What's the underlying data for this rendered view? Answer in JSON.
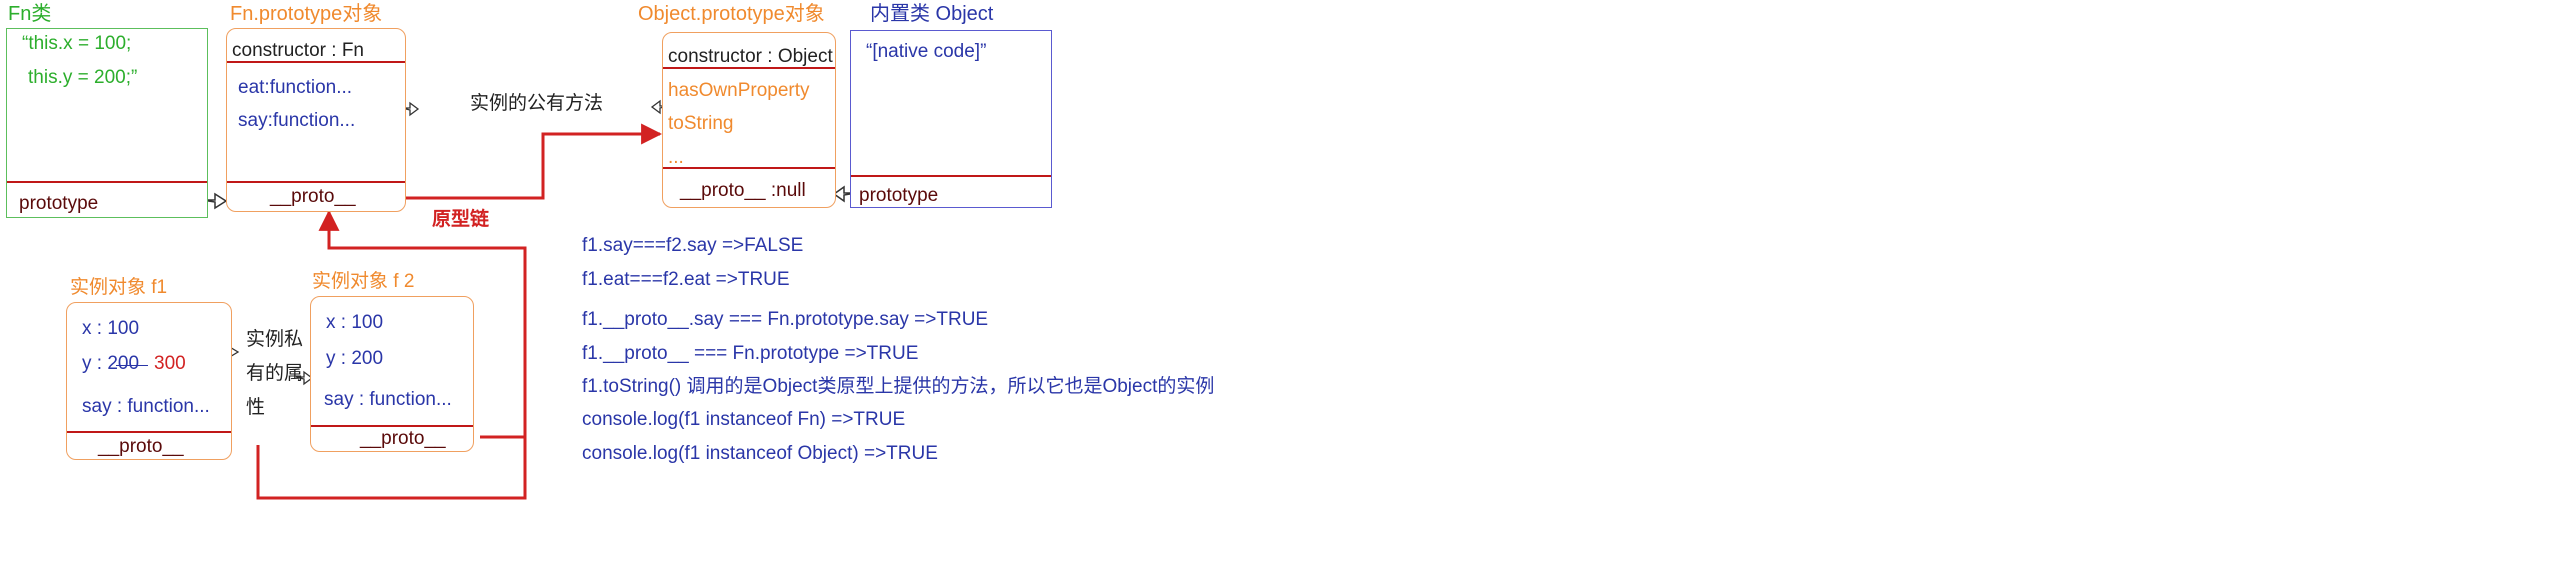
{
  "fn_box": {
    "title": "Fn类",
    "code_line1": "“this.x = 100;",
    "code_line2": "this.y = 200;”",
    "prototype": "prototype"
  },
  "fn_prototype_box": {
    "title": "Fn.prototype对象",
    "constructor": "constructor : Fn",
    "method1": "eat:function...",
    "method2": "say:function...",
    "proto": "__proto__"
  },
  "public_methods_label": "实例的公有方法",
  "object_prototype_box": {
    "title": "Object.prototype对象",
    "constructor": "constructor : Object",
    "method1": "hasOwnProperty",
    "method2": "toString",
    "ellipsis": "...",
    "proto": "__proto__ :null"
  },
  "object_box": {
    "title": "内置类 Object",
    "code": "“[native code]”",
    "prototype": "prototype"
  },
  "prototype_chain_label": "原型链",
  "instance_f1": {
    "title": "实例对象  f1",
    "x": "x : 100",
    "y_old": "y : 200",
    "y_new": "300",
    "say": "say : function...",
    "proto": "__proto__"
  },
  "private_label": {
    "line1": "实例私",
    "line2": "有的属",
    "line3": "性"
  },
  "instance_f2": {
    "title": "实例对象  f 2",
    "x": "x : 100",
    "y": "y : 200",
    "say": "say : function...",
    "proto": "__proto__"
  },
  "notes": [
    "f1.say===f2.say    =>FALSE",
    "f1.eat===f2.eat     =>TRUE",
    "f1.__proto__.say   === Fn.prototype.say    =>TRUE",
    "f1.__proto__ === Fn.prototype    =>TRUE",
    "f1.toString()    调用的是Object类原型上提供的方法，所以它也是Object的实例",
    "console.log(f1 instanceof Fn)    =>TRUE",
    "console.log(f1 instanceof Object)    =>TRUE"
  ],
  "colors": {
    "orange": "#f08a2e",
    "blue": "#2a36a8",
    "green": "#2cae2c",
    "red": "#d22222",
    "dark_red": "#5a0a0a"
  }
}
